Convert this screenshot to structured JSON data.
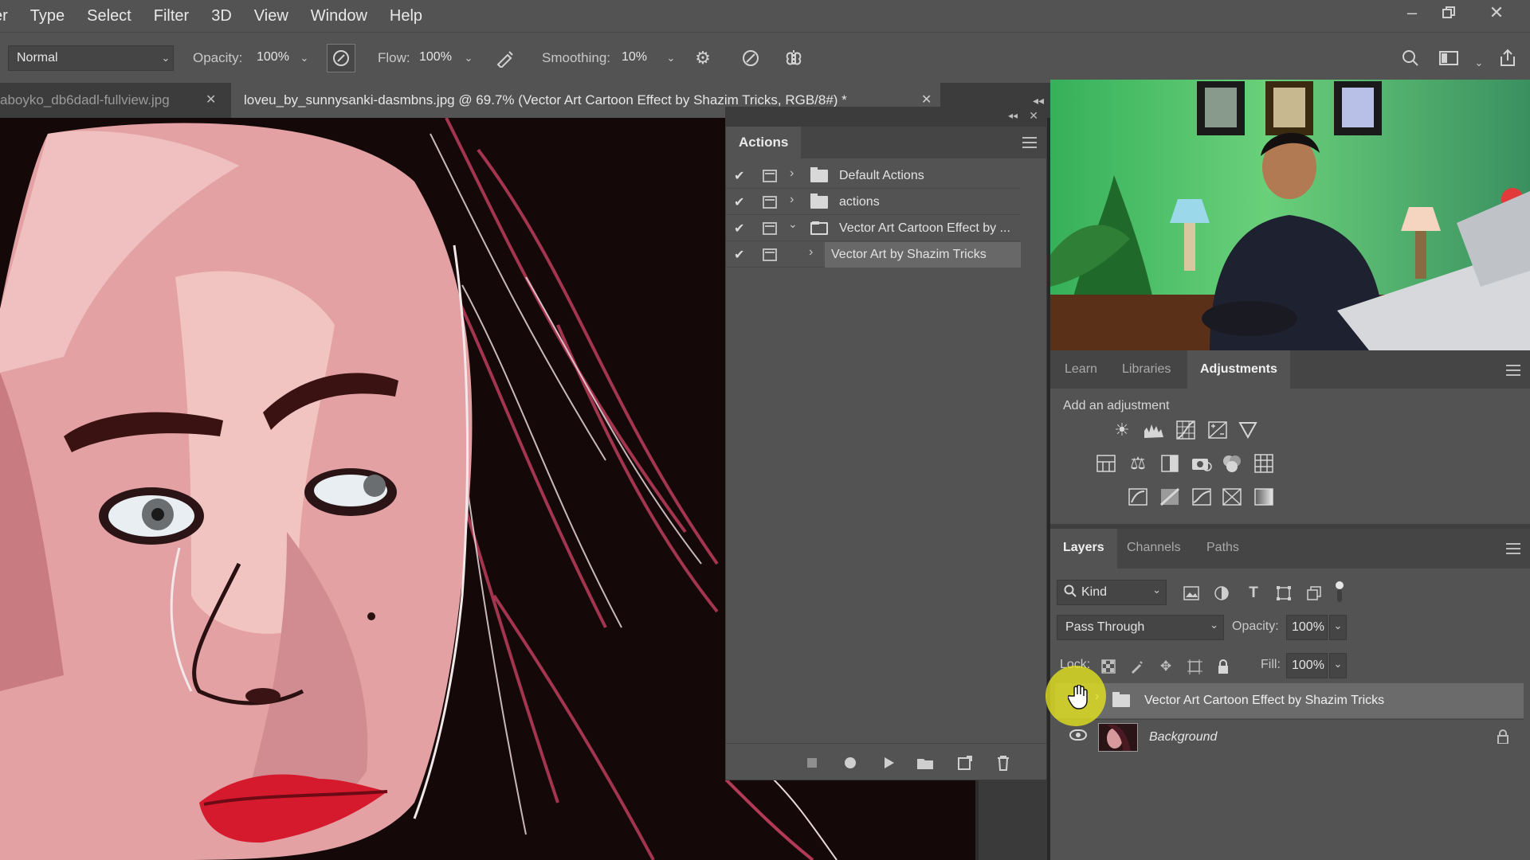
{
  "menubar": {
    "items": [
      "er",
      "Type",
      "Select",
      "Filter",
      "3D",
      "View",
      "Window",
      "Help"
    ],
    "window_controls": [
      "minimize-icon",
      "restore-icon",
      "close-icon"
    ]
  },
  "options": {
    "blend_mode": "Normal",
    "opacity_label": "Opacity:",
    "opacity_value": "100%",
    "flow_label": "Flow:",
    "flow_value": "100%",
    "smoothing_label": "Smoothing:",
    "smoothing_value": "10%"
  },
  "tabs": [
    {
      "label": "aboyko_db6dadl-fullview.jpg",
      "active": false
    },
    {
      "label": "loveu_by_sunnysanki-dasmbns.jpg @ 69.7% (Vector Art Cartoon Effect by Shazim Tricks, RGB/8#) *",
      "active": true
    }
  ],
  "actions_panel": {
    "title": "Actions",
    "rows": [
      {
        "label": "Default Actions",
        "type": "set",
        "expanded": false
      },
      {
        "label": "actions",
        "type": "set",
        "expanded": false
      },
      {
        "label": "Vector Art Cartoon Effect by ...",
        "type": "set",
        "expanded": true
      },
      {
        "label": "Vector Art by Shazim Tricks",
        "type": "action",
        "selected": true
      }
    ],
    "footer_icons": [
      "stop-icon",
      "record-icon",
      "play-icon",
      "new-set-icon",
      "new-action-icon",
      "delete-icon"
    ]
  },
  "adjust_panel": {
    "tabs": [
      "Learn",
      "Libraries",
      "Adjustments"
    ],
    "active_tab": "Adjustments",
    "heading": "Add an adjustment"
  },
  "layers_panel": {
    "tabs": [
      "Layers",
      "Channels",
      "Paths"
    ],
    "filter_kind": "Kind",
    "blend_mode": "Pass Through",
    "opacity_label": "Opacity:",
    "opacity_value": "100%",
    "lock_label": "Lock:",
    "fill_label": "Fill:",
    "fill_value": "100%",
    "layers": [
      {
        "name": "Vector Art Cartoon Effect by Shazim Tricks",
        "type": "group",
        "selected": true
      },
      {
        "name": "Background",
        "type": "image",
        "locked": true
      }
    ]
  },
  "colors": {
    "accent_highlight": "#e6e61e",
    "panel_bg": "#535353",
    "canvas_bg": "#150809"
  }
}
